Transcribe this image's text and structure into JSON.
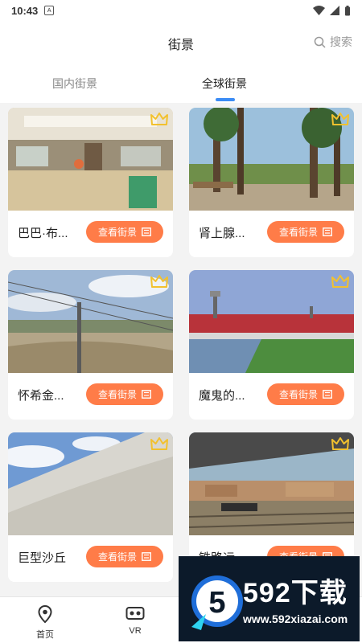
{
  "status_bar": {
    "time": "10:43",
    "app_badge": "A"
  },
  "header": {
    "title": "街景",
    "search_label": "搜索"
  },
  "tabs": [
    {
      "label": "国内街景",
      "active": false
    },
    {
      "label": "全球街景",
      "active": true
    }
  ],
  "cards": [
    {
      "name": "巴巴·布...",
      "button": "查看街景",
      "scene": "hall"
    },
    {
      "name": "肾上腺...",
      "button": "查看街景",
      "scene": "forest"
    },
    {
      "name": "怀希金...",
      "button": "查看街景",
      "scene": "mine"
    },
    {
      "name": "魔鬼的...",
      "button": "查看街景",
      "scene": "stadium"
    },
    {
      "name": "巨型沙丘",
      "button": "查看街景",
      "scene": "dune"
    },
    {
      "name": "铁路运...",
      "button": "查看街景",
      "scene": "railway"
    }
  ],
  "bottom_nav": [
    {
      "label": "首页",
      "icon": "location-pin-icon"
    },
    {
      "label": "VR",
      "icon": "vr-headset-icon"
    }
  ],
  "watermark": {
    "number": "592下载",
    "url": "www.592xiazai.com"
  },
  "colors": {
    "accent": "#ff7c48",
    "tab_indicator": "#3b8cf5",
    "crown": "#f2c12e"
  }
}
